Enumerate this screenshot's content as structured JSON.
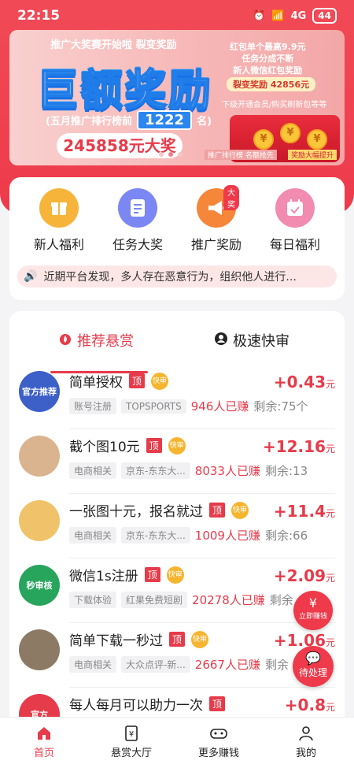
{
  "status_bar": {
    "time": "22:15",
    "signal": "4G",
    "battery": "44"
  },
  "banner": {
    "slogan": "推广大奖赛开始啦  裂变奖励",
    "headline": "巨额奖励",
    "rank_label_pre": "(五月推广排行榜前",
    "rank_number": "1222",
    "rank_label_post": "名)",
    "prize": "245858元大奖",
    "right_line1": "红包单个最高9.9元",
    "right_line2": "任务分成不断",
    "right_line3": "新人微信红包奖励",
    "fission_reward": "裂变奖励 42856元",
    "right_line4": "下级开通会员/购买刷新包等等",
    "coin_symbol": "¥",
    "bottom_tag1": "推广排行榜 名额抢先",
    "bottom_tag2": "奖励大幅提升"
  },
  "menu": {
    "items": [
      {
        "label": "新人福利",
        "icon": "gift-box-icon",
        "color": "#f6b53a"
      },
      {
        "label": "任务大奖",
        "icon": "task-list-icon",
        "color": "#7b87f2"
      },
      {
        "label": "推广奖励",
        "icon": "megaphone-icon",
        "color": "#f6873a",
        "badge": "大奖"
      },
      {
        "label": "每日福利",
        "icon": "calendar-icon",
        "color": "#f28bb0"
      }
    ],
    "notice": "近期平台发现，多人存在恶意行为，组织他人进行..."
  },
  "tabs": [
    {
      "label": "推荐悬赏",
      "icon": "fire-icon"
    },
    {
      "label": "极速快审",
      "icon": "user-circle-icon"
    }
  ],
  "task_tags": {
    "top": "顶",
    "fast": "快审"
  },
  "tasks": [
    {
      "title": "简单授权",
      "avatar_text": "官方推荐",
      "avatar_color": "#3c5fc8",
      "tags": [
        "账号注册",
        "TOPSPORTS"
      ],
      "earned": "946人已赚",
      "remain": "剩余:75个",
      "price": "+0.43",
      "fast": true
    },
    {
      "title": "截个图10元",
      "avatar_text": "",
      "avatar_color": "#d9b48f",
      "tags": [
        "电商相关",
        "京东-东东大..."
      ],
      "earned": "8033人已赚",
      "remain": "剩余:13",
      "price": "+12.16",
      "fast": true
    },
    {
      "title": "一张图十元，报名就过",
      "avatar_text": "",
      "avatar_color": "#f0c36a",
      "tags": [
        "电商相关",
        "京东-东东大..."
      ],
      "earned": "1009人已赚",
      "remain": "剩余:66",
      "price": "+11.4",
      "fast": true
    },
    {
      "title": "微信1s注册",
      "avatar_text": "秒审核",
      "avatar_color": "#27a55c",
      "tags": [
        "下载体验",
        "红果免费短剧"
      ],
      "earned": "20278人已赚",
      "remain": "剩余",
      "price": "+2.09",
      "fast": true
    },
    {
      "title": "简单下载一秒过",
      "avatar_text": "",
      "avatar_color": "#8c7a65",
      "tags": [
        "电商相关",
        "大众点评-新..."
      ],
      "earned": "2667人已赚",
      "remain": "剩余",
      "price": "+1.06",
      "fast": true
    },
    {
      "title": "每人每月可以助力一次",
      "avatar_text": "官方",
      "avatar_color": "#e63b4a",
      "tags": [],
      "earned": "",
      "remain": "",
      "price": "+0.8",
      "fast": false
    }
  ],
  "price_unit": "元",
  "floating": {
    "quick_earn": "立即赚钱",
    "quick_earn_symbol": "¥",
    "pending": "待处理"
  },
  "bottom_nav": [
    {
      "label": "首页",
      "icon": "home-icon"
    },
    {
      "label": "悬赏大厅",
      "icon": "reward-hall-icon"
    },
    {
      "label": "更多赚钱",
      "icon": "gamepad-icon"
    },
    {
      "label": "我的",
      "icon": "profile-icon"
    }
  ],
  "accent_color": "#e63b4a"
}
